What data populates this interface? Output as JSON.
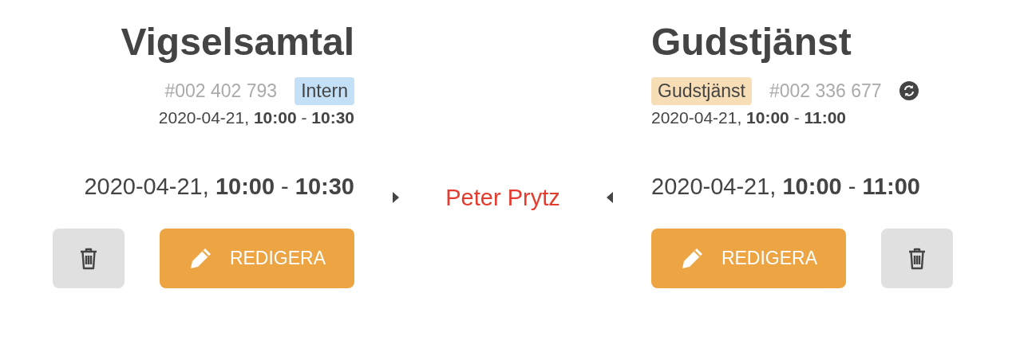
{
  "left": {
    "title": "Vigselsamtal",
    "meta": [
      {
        "kind": "number",
        "text": "#002 402 793"
      },
      {
        "kind": "tag",
        "text": "Intern",
        "color": "#c3e0f7"
      }
    ],
    "date": "2020-04-21, **10:00** - **10:30**",
    "time": "2020-04-21, **10:00** - **10:30**",
    "buttons": [
      {
        "kind": "delete"
      },
      {
        "kind": "edit",
        "label": "REDIGERA"
      }
    ]
  },
  "center": {
    "name": "Peter Prytz"
  },
  "right": {
    "title": "Gudstjänst",
    "meta": [
      {
        "kind": "tag",
        "text": "Gudstjänst",
        "color": "#f8deb6"
      },
      {
        "kind": "number",
        "text": "#002 336 677"
      },
      {
        "kind": "sync"
      }
    ],
    "date": "2020-04-21, **10:00** - **11:00**",
    "time": "2020-04-21, **10:00** - **11:00**",
    "buttons": [
      {
        "kind": "edit",
        "label": "REDIGERA"
      },
      {
        "kind": "delete"
      }
    ]
  }
}
